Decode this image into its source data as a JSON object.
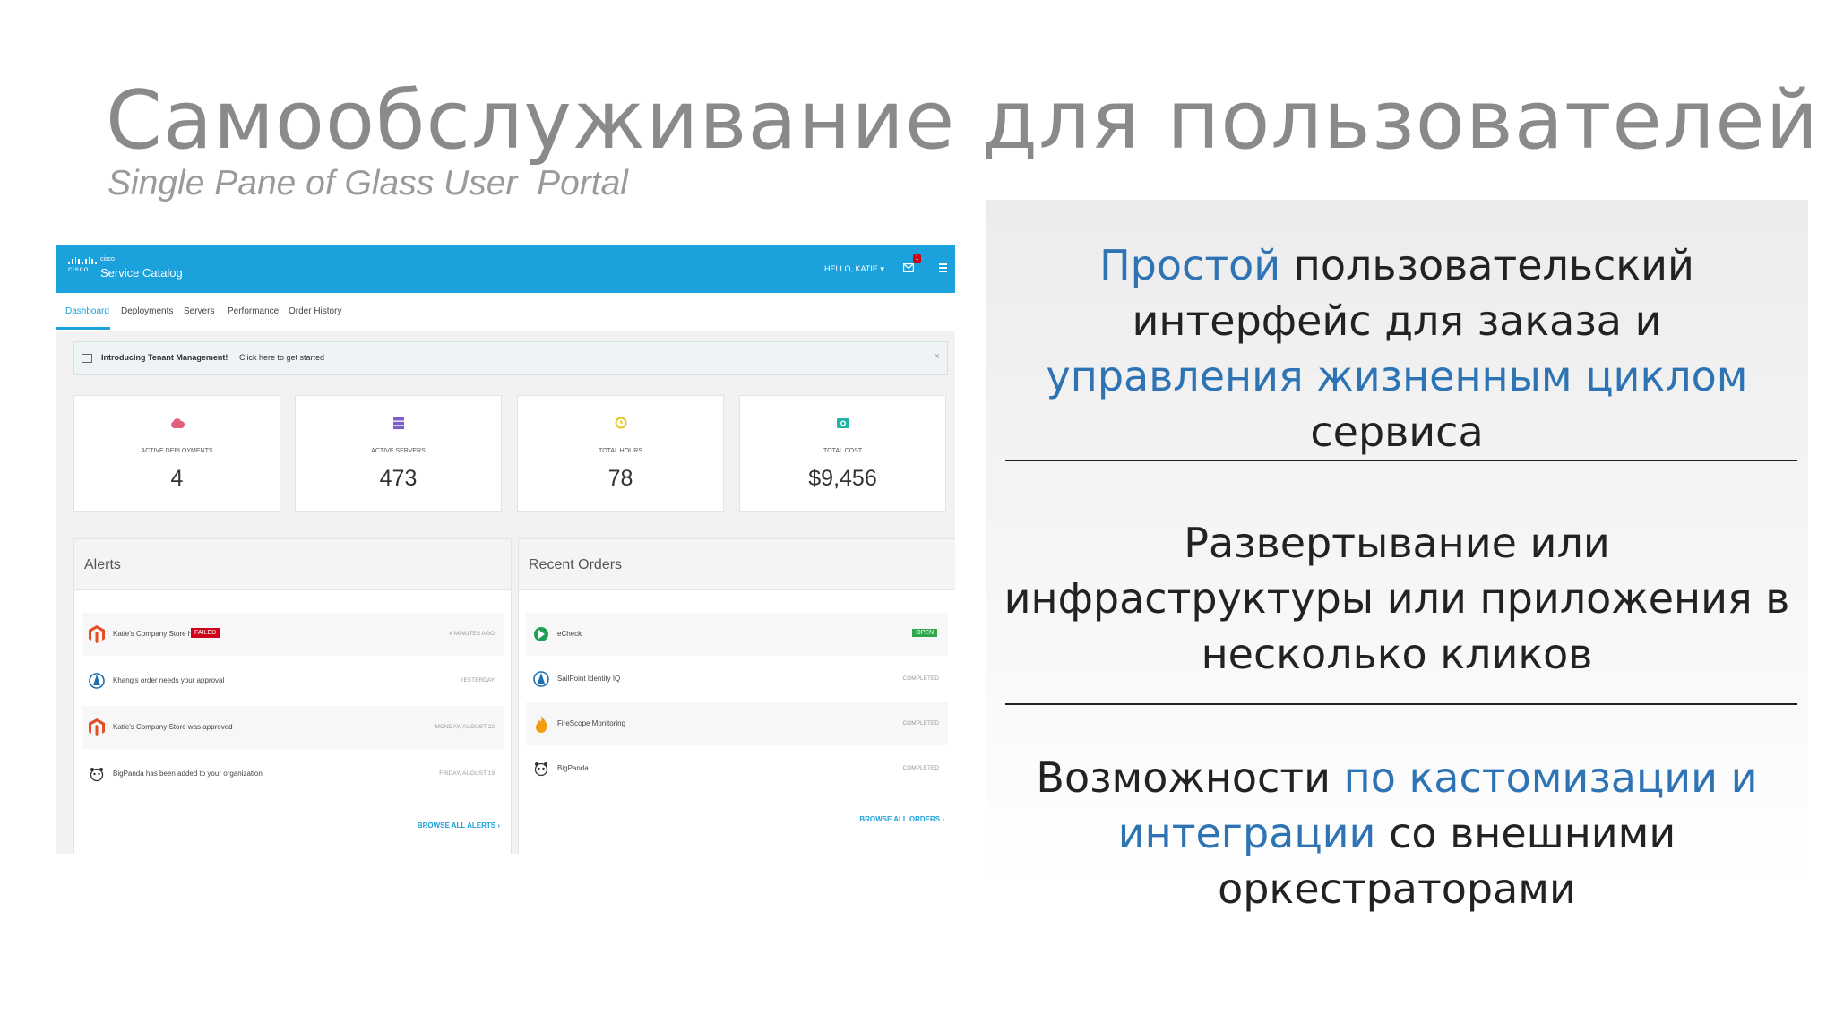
{
  "slide": {
    "title": "Самообслуживание для пользователей",
    "subtitle": "Single Pane of Glass User  Portal"
  },
  "portal": {
    "brand_small": "cisco",
    "brand_logo_word": "cisco",
    "brand_main": "Service Catalog",
    "user_greeting": "HELLO, KATIE",
    "notification_count": "1",
    "tabs": [
      {
        "label": "Dashboard",
        "active": true
      },
      {
        "label": "Deployments",
        "active": false
      },
      {
        "label": "Servers",
        "active": false
      },
      {
        "label": "Performance",
        "active": false
      },
      {
        "label": "Order History",
        "active": false
      }
    ],
    "banner": {
      "title": "Introducing Tenant Management!",
      "link": "Click here to get started",
      "close": "×"
    },
    "stats": [
      {
        "label": "ACTIVE DEPLOYMENTS",
        "value": "4",
        "icon": "cloud-icon",
        "color": "#e0607e"
      },
      {
        "label": "ACTIVE SERVERS",
        "value": "473",
        "icon": "server-icon",
        "color": "#7b5fc7"
      },
      {
        "label": "TOTAL HOURS",
        "value": "78",
        "icon": "clock-icon",
        "color": "#e6c619"
      },
      {
        "label": "TOTAL COST",
        "value": "$9,456",
        "icon": "money-icon",
        "color": "#1fb5a5"
      }
    ],
    "alerts": {
      "title": "Alerts",
      "items": [
        {
          "text": "Katie's Company Store has",
          "badge": "FAILED",
          "time": "4 MINUTES AGO",
          "icon": "magento-icon"
        },
        {
          "text": "Khang's order needs your approval",
          "time": "YESTERDAY",
          "icon": "sailpoint-icon"
        },
        {
          "text": "Katie's Company Store was approved",
          "time": "MONDAY, AUGUST 22",
          "icon": "magento-icon"
        },
        {
          "text": "BigPanda has been added to your organization",
          "time": "FRIDAY, AUGUST 19",
          "icon": "panda-icon"
        }
      ],
      "browse": "BROWSE ALL ALERTS ›"
    },
    "orders": {
      "title": "Recent Orders",
      "items": [
        {
          "text": "eCheck",
          "status": "OPEN",
          "icon": "echeck-icon"
        },
        {
          "text": "SailPoint Identity IQ",
          "status": "COMPLETED",
          "icon": "sailpoint-icon"
        },
        {
          "text": "FireScope Monitoring",
          "status": "COMPLETED",
          "icon": "firescope-icon"
        },
        {
          "text": "BigPanda",
          "status": "COMPLETED",
          "icon": "panda-icon"
        }
      ],
      "browse": "BROWSE ALL ORDERS ›"
    },
    "colors": {
      "header": "#1ba1dc",
      "failed": "#d0021b",
      "open": "#2ea84a"
    }
  },
  "info": {
    "block1": {
      "part1": "Простой",
      "part2": " пользовательский интерфейс для заказа и ",
      "part3": "управления жизненным циклом",
      "part4": " сервиса"
    },
    "block2": {
      "text": "Развертывание или инфраструктуры или приложения в несколько кликов"
    },
    "block3": {
      "part1": "Возможности ",
      "part2": "по кастомизации и интеграции",
      "part3": " со внешними оркестраторами"
    },
    "accent_color": "#2e74b5"
  }
}
